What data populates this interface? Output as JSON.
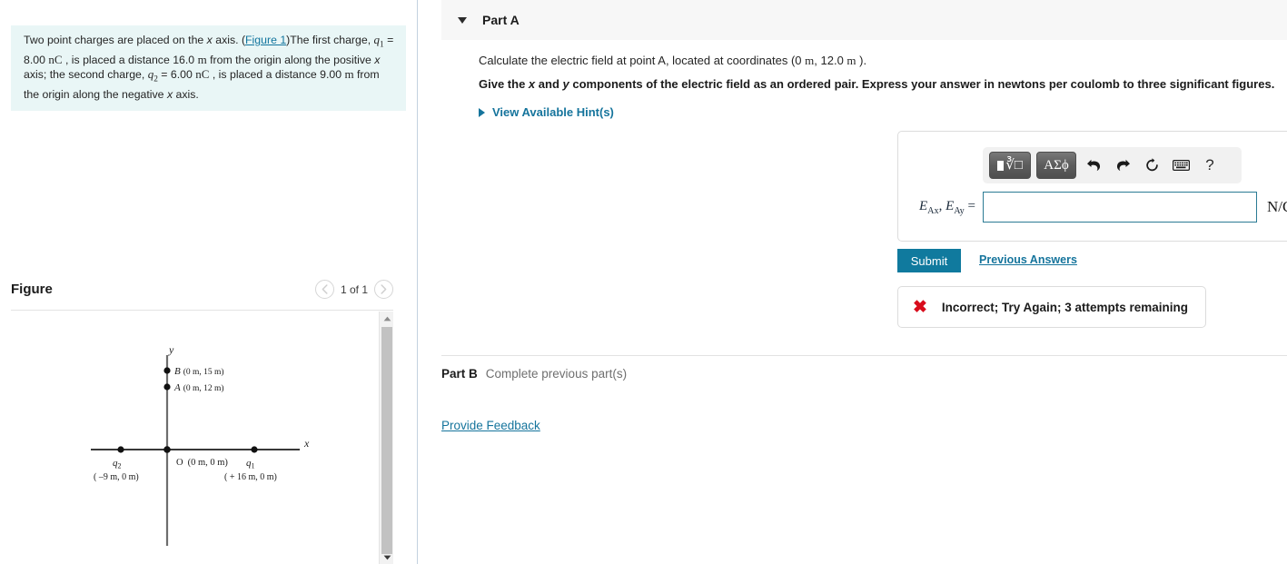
{
  "left": {
    "problem": {
      "seg1": "Two point charges are placed on the ",
      "x1": "x",
      "seg2": " axis. (",
      "figure_link": "Figure 1",
      "seg3": ")The first charge, ",
      "q1_label": "q",
      "q1_sub": "1",
      "seg4": " = 8.00 ",
      "unit_nC_1": "nC",
      "seg5": " , is placed a distance 16.0 ",
      "unit_m_1": "m",
      "seg6": " from the origin along the positive ",
      "x2": "x",
      "seg7": " axis; the second charge, ",
      "q2_label": "q",
      "q2_sub": "2",
      "seg8": " = 6.00 ",
      "unit_nC_2": "nC",
      "seg9": " , is placed a distance 9.00 ",
      "unit_m_2": "m",
      "seg10": " from the origin along the negative ",
      "x3": "x",
      "seg11": " axis."
    },
    "figure": {
      "title": "Figure",
      "counter": "1 of 1",
      "prev_icon": "chevron-left-icon",
      "next_icon": "chevron-right-icon",
      "scroll_up_icon": "triangle-up-icon",
      "scroll_down_icon": "triangle-down-icon",
      "diagram": {
        "y_axis_label": "y",
        "x_axis_label": "x",
        "points": [
          {
            "name": "B",
            "label": "B",
            "coords": "(0 m, 15 m)"
          },
          {
            "name": "A",
            "label": "A",
            "coords": "(0 m, 12 m)"
          },
          {
            "name": "O",
            "label": "O",
            "coords": "(0 m, 0 m)"
          },
          {
            "name": "q1",
            "label": "q",
            "sub": "1",
            "coords": "( + 16 m, 0 m)"
          },
          {
            "name": "q2",
            "label": "q",
            "sub": "2",
            "coords": "( –9 m, 0 m)"
          }
        ]
      }
    }
  },
  "right": {
    "part_a": {
      "caret_icon": "caret-down-icon",
      "title": "Part A",
      "question_pre": "Calculate the electric field at point A, located at coordinates (0 ",
      "question_m1": "m",
      "question_mid": ", 12.0 ",
      "question_m2": "m",
      "question_post": " ).",
      "instruction_pre": "Give the ",
      "instruction_x": "x",
      "instruction_and": " and ",
      "instruction_y": "y",
      "instruction_post": " components of the electric field as an ordered pair. Express your answer in newtons per coulomb to three significant figures.",
      "hint_label": "View Available Hint(s)",
      "hint_icon": "triangle-right-icon",
      "toolbar": [
        {
          "name": "math-template-button",
          "icon": "square-root-template-icon",
          "label": ""
        },
        {
          "name": "greek-symbols-button",
          "icon": "greek-letters-icon",
          "label": "ΑΣϕ"
        },
        {
          "name": "undo-button",
          "icon": "undo-arrow-icon",
          "label": ""
        },
        {
          "name": "redo-button",
          "icon": "redo-arrow-icon",
          "label": ""
        },
        {
          "name": "reset-button",
          "icon": "refresh-circle-icon",
          "label": ""
        },
        {
          "name": "keyboard-button",
          "icon": "keyboard-icon",
          "label": ""
        },
        {
          "name": "help-button",
          "icon": "question-mark-icon",
          "label": "?"
        }
      ],
      "answer_label_E": "E",
      "answer_label_sub1": "Ax",
      "answer_label_sub2": "Ay",
      "answer_label_eq": "=",
      "answer_value": "",
      "answer_placeholder": "",
      "answer_unit": "N/C",
      "submit_label": "Submit",
      "previous_answers_label": "Previous Answers",
      "result_icon": "red-x-icon",
      "result_text": "Incorrect; Try Again; 3 attempts remaining"
    },
    "part_b": {
      "title": "Part B",
      "status": "Complete previous part(s)"
    },
    "feedback_label": "Provide Feedback"
  },
  "colors": {
    "accent": "#15749c",
    "submit_bg": "#107a9e",
    "problem_bg": "#e9f6f6",
    "header_bg": "#f7f7f7",
    "error": "#d80c1c"
  }
}
